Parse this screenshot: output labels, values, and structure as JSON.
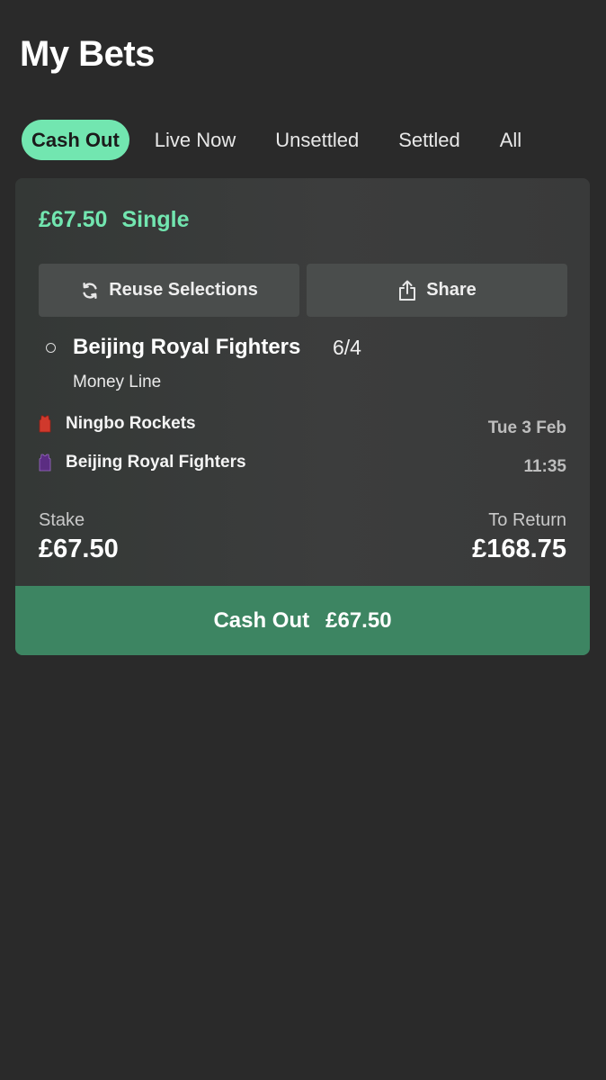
{
  "page": {
    "title": "My Bets"
  },
  "tabs": [
    {
      "label": "Cash Out",
      "active": true
    },
    {
      "label": "Live Now",
      "active": false
    },
    {
      "label": "Unsettled",
      "active": false
    },
    {
      "label": "Settled",
      "active": false
    },
    {
      "label": "All",
      "active": false
    }
  ],
  "bet": {
    "stake_amount": "£67.50",
    "bet_type": "Single",
    "reuse_label": "Reuse Selections",
    "share_label": "Share",
    "selection": {
      "name": "Beijing Royal Fighters",
      "odds": "6/4",
      "market": "Money Line"
    },
    "event": {
      "home_team": "Ningbo Rockets",
      "away_team": "Beijing Royal Fighters",
      "home_kit_icon": "jersey-icon",
      "away_kit_icon": "jersey-icon",
      "date": "Tue 3 Feb",
      "time": "11:35"
    },
    "stake_label": "Stake",
    "stake_value": "£67.50",
    "return_label": "To Return",
    "return_value": "£168.75",
    "cashout_label": "Cash Out",
    "cashout_value": "£67.50"
  },
  "colors": {
    "background": "#2a2a2a",
    "accent": "#72e6b0",
    "cashout_button": "#3d8562",
    "home_kit": "#d0392c",
    "away_kit": "#5b2d82"
  }
}
